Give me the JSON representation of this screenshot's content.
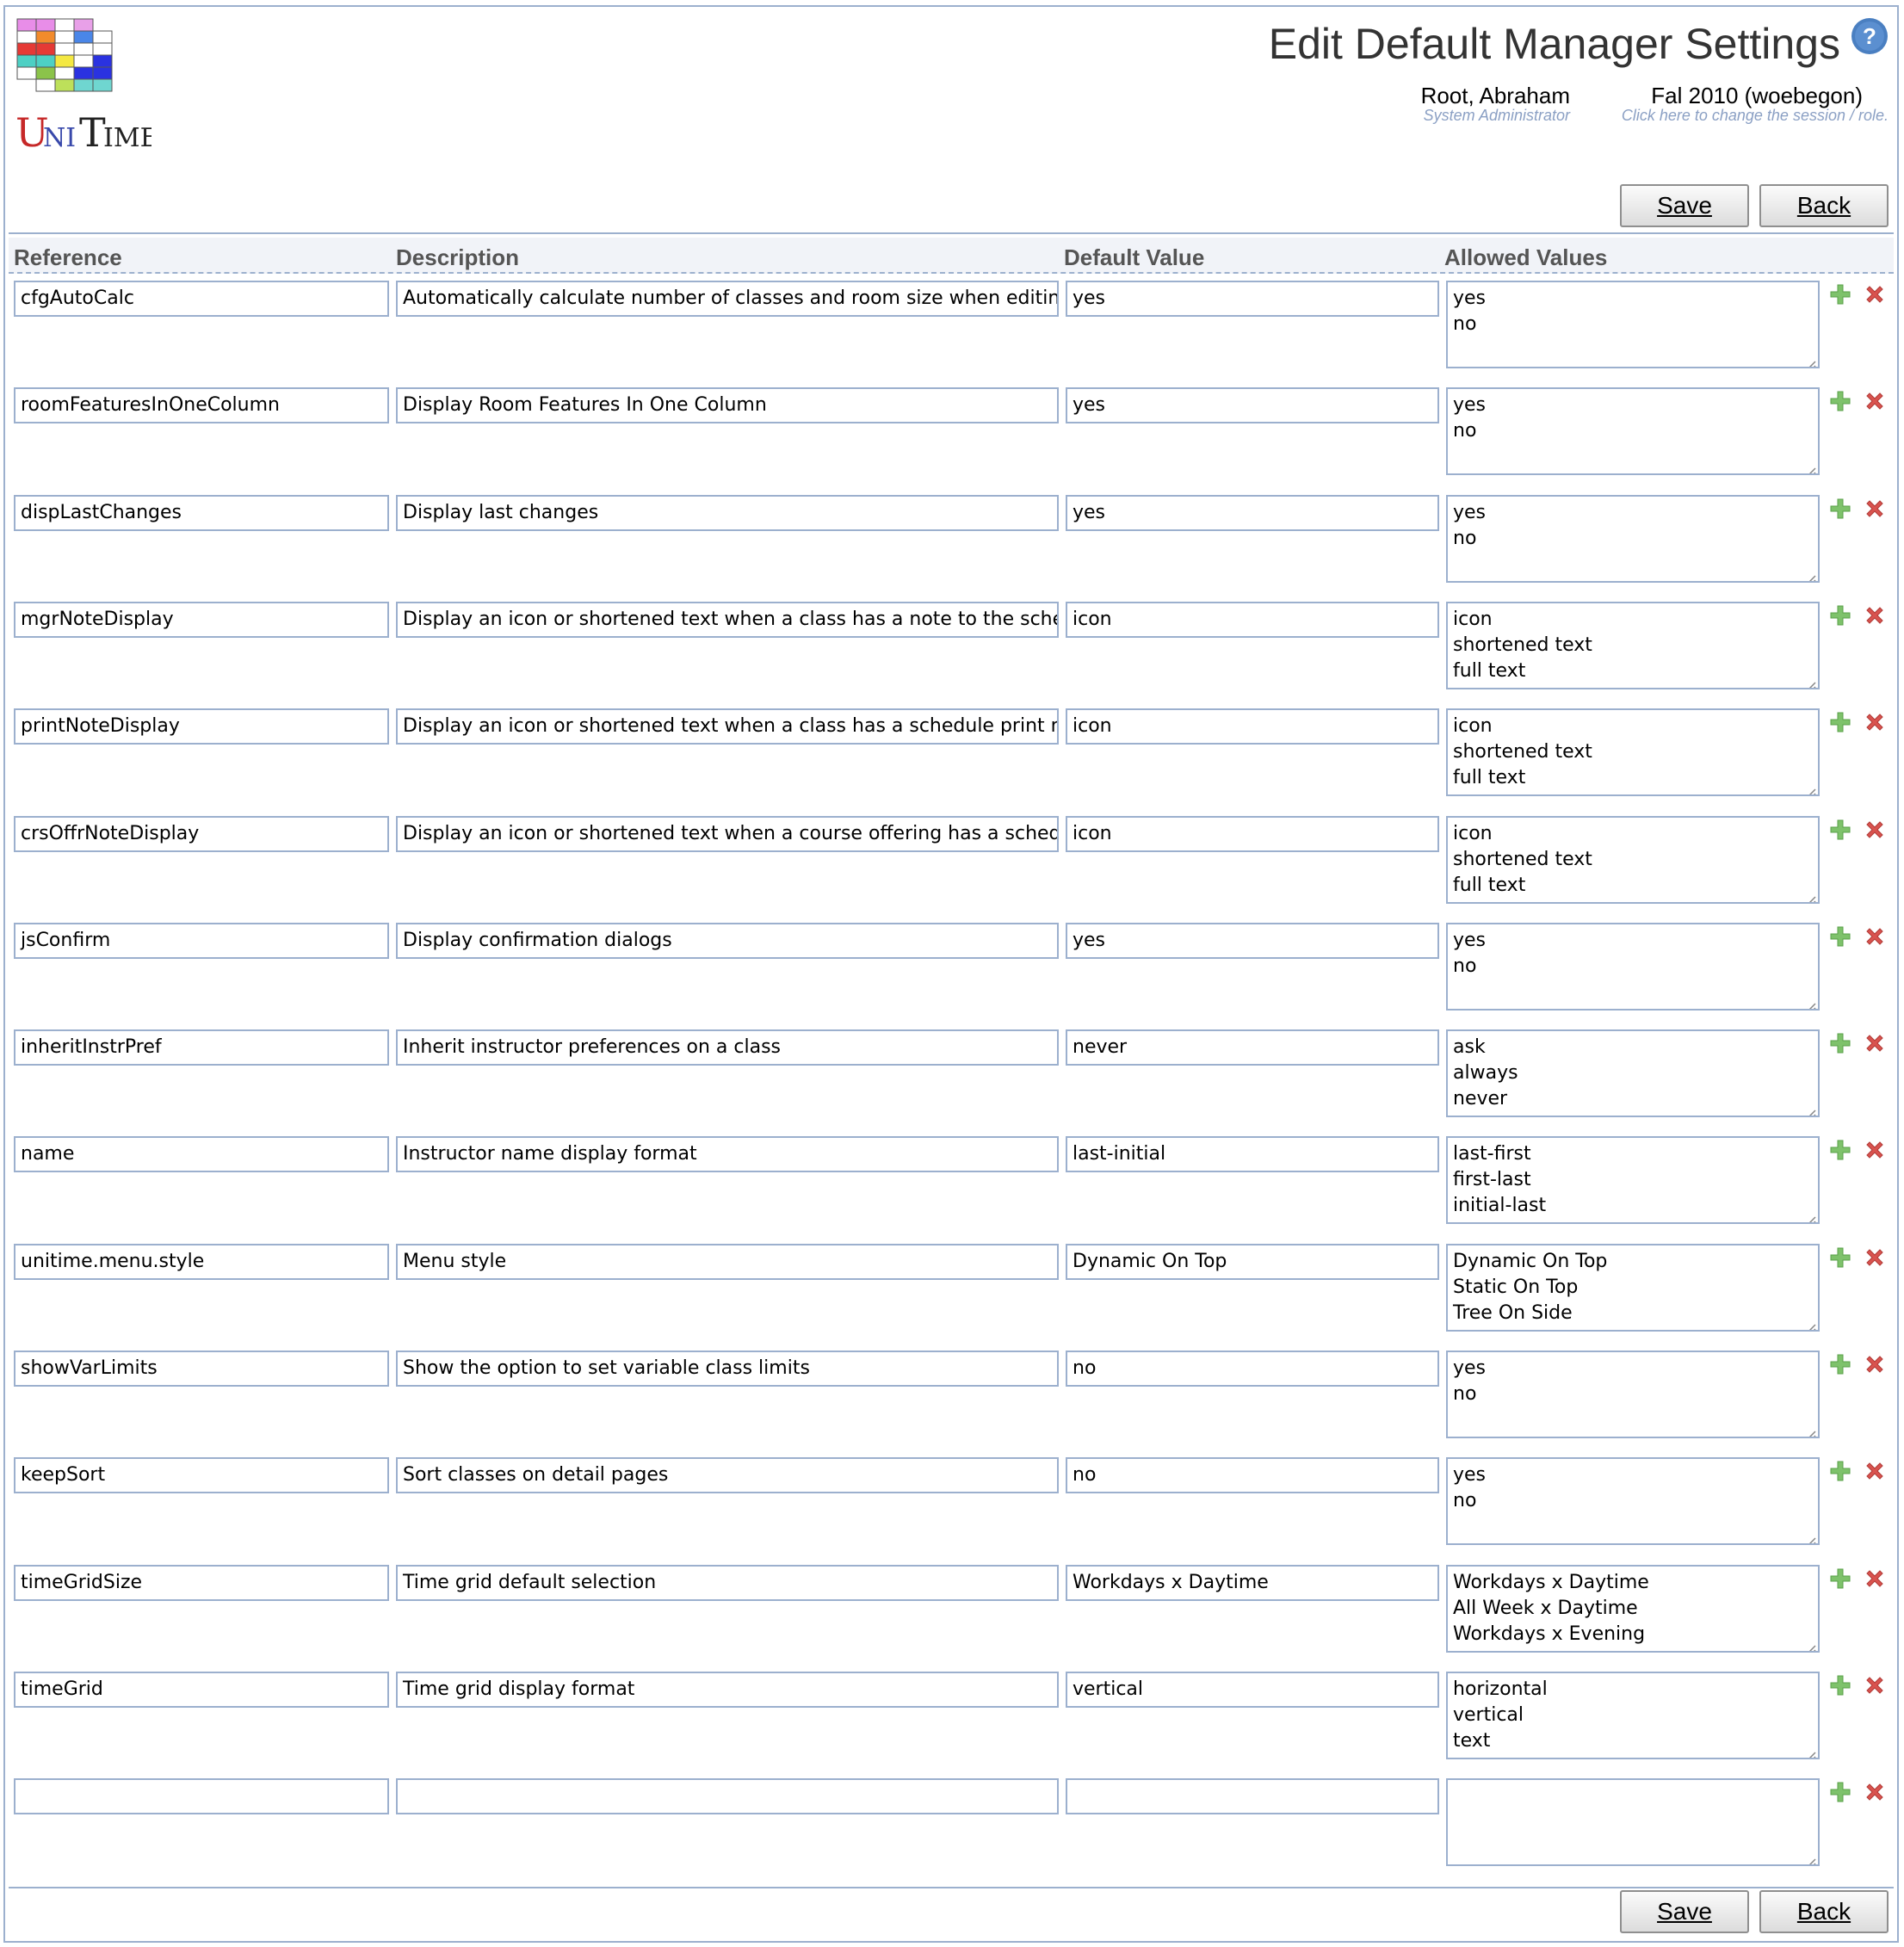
{
  "app": {
    "logo_text": "UNITIME"
  },
  "header": {
    "title": "Edit Default Manager Settings",
    "user_name": "Root, Abraham",
    "user_role": "System Administrator",
    "session_name": "Fal 2010 (woebegon)",
    "session_hint": "Click here to change the session / role."
  },
  "buttons": {
    "save_label": "Save",
    "back_label": "Back"
  },
  "columns": {
    "reference": "Reference",
    "description": "Description",
    "default_value": "Default Value",
    "allowed_values": "Allowed Values"
  },
  "rows": [
    {
      "reference": "cfgAutoCalc",
      "description": "Automatically calculate number of classes and room size when editing",
      "default": "yes",
      "allowed": "yes\nno"
    },
    {
      "reference": "roomFeaturesInOneColumn",
      "description": "Display Room Features In One Column",
      "default": "yes",
      "allowed": "yes\nno"
    },
    {
      "reference": "dispLastChanges",
      "description": "Display last changes",
      "default": "yes",
      "allowed": "yes\nno"
    },
    {
      "reference": "mgrNoteDisplay",
      "description": "Display an icon or shortened text when a class has a note to the schec",
      "default": "icon",
      "allowed": "icon\nshortened text\nfull text"
    },
    {
      "reference": "printNoteDisplay",
      "description": "Display an icon or shortened text when a class has a schedule print nc",
      "default": "icon",
      "allowed": "icon\nshortened text\nfull text"
    },
    {
      "reference": "crsOffrNoteDisplay",
      "description": "Display an icon or shortened text when a course offering has a schedu",
      "default": "icon",
      "allowed": "icon\nshortened text\nfull text"
    },
    {
      "reference": "jsConfirm",
      "description": "Display confirmation dialogs",
      "default": "yes",
      "allowed": "yes\nno"
    },
    {
      "reference": "inheritInstrPref",
      "description": "Inherit instructor preferences on a class",
      "default": "never",
      "allowed": "ask\nalways\nnever"
    },
    {
      "reference": "name",
      "description": "Instructor name display format",
      "default": "last-initial",
      "allowed": "last-first\nfirst-last\ninitial-last"
    },
    {
      "reference": "unitime.menu.style",
      "description": "Menu style",
      "default": "Dynamic On Top",
      "allowed": "Dynamic On Top\nStatic On Top\nTree On Side"
    },
    {
      "reference": "showVarLimits",
      "description": "Show the option to set variable class limits",
      "default": "no",
      "allowed": "yes\nno"
    },
    {
      "reference": "keepSort",
      "description": "Sort classes on detail pages",
      "default": "no",
      "allowed": "yes\nno"
    },
    {
      "reference": "timeGridSize",
      "description": "Time grid default selection",
      "default": "Workdays x Daytime",
      "allowed": "Workdays x Daytime\nAll Week x Daytime\nWorkdays x Evening"
    },
    {
      "reference": "timeGrid",
      "description": "Time grid display format",
      "default": "vertical",
      "allowed": "horizontal\nvertical\ntext"
    },
    {
      "reference": "",
      "description": "",
      "default": "",
      "allowed": ""
    }
  ],
  "icons": {
    "add": "add-icon",
    "delete": "delete-icon",
    "help": "help-icon"
  },
  "colors": {
    "border": "#9cb0ce",
    "add_green": "#7ec26b",
    "delete_red": "#d9534f",
    "hint_blue": "#8ba0c4"
  }
}
